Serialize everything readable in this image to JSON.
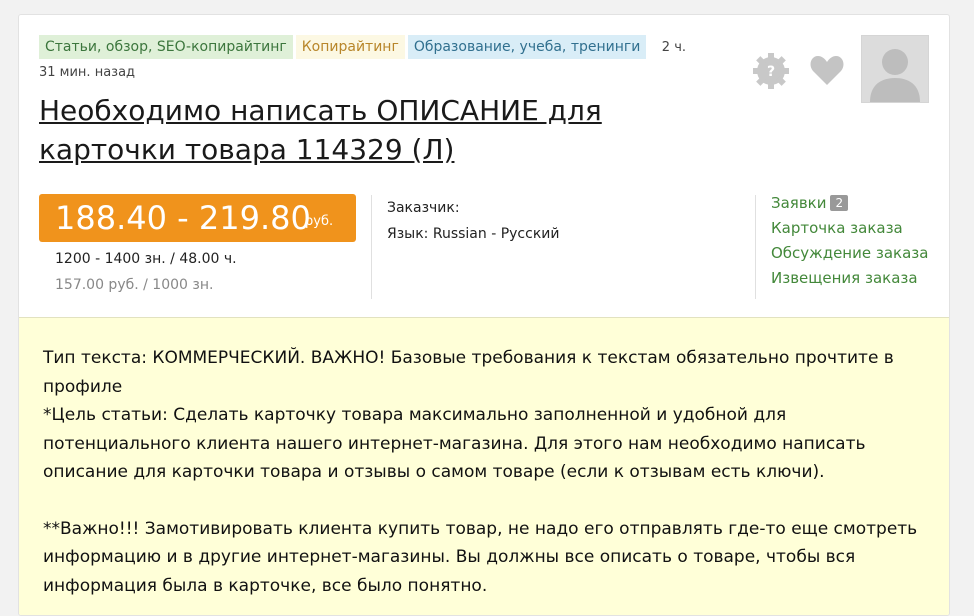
{
  "tags": [
    "Статьи, обзор, SEO-копирайтинг",
    "Копирайтинг",
    "Образование, учеба, тренинги"
  ],
  "time": {
    "line1": "2 ч.",
    "line2": "31 мин. назад"
  },
  "title": "Необходимо написать ОПИСАНИЕ для карточки товара 114329 (Л)",
  "icons": {
    "help": "question-gear-icon",
    "favorite": "heart-icon",
    "avatar": "user-avatar"
  },
  "price": {
    "range": "188.40 - 219.80",
    "currency": "руб.",
    "chars_time": "1200 - 1400 зн.  / 48.00 ч.",
    "rate": "157.00 руб.  / 1000 зн."
  },
  "customer": {
    "label": "Заказчик:",
    "language": "Язык: Russian - Русский"
  },
  "links": {
    "applications": "Заявки",
    "applications_count": "2",
    "card": "Карточка заказа",
    "discussion": "Обсуждение заказа",
    "notices": "Извещения заказа"
  },
  "description": {
    "line1": "Тип текста: КОММЕРЧЕСКИЙ. ВАЖНО! Базовые требования к текстам обязательно прочтите в профиле",
    "line2": "*Цель статьи: Сделать карточку товара максимально заполненной и удобной для потенциального клиента нашего интернет-магазина. Для этого нам необходимо написать описание для карточки товара и отзывы о самом товаре (если к отзывам есть ключи).",
    "line3": "**Важно!!! Замотивировать клиента купить товар, не надо его отправлять где-то еще смотреть информацию и в другие интернет-магазины. Вы должны все описать о товаре, чтобы вся информация была в карточке, все было понятно."
  },
  "colors": {
    "accent_orange": "#f0931c",
    "link_green": "#43883a",
    "desc_bg": "#ffffd8"
  }
}
